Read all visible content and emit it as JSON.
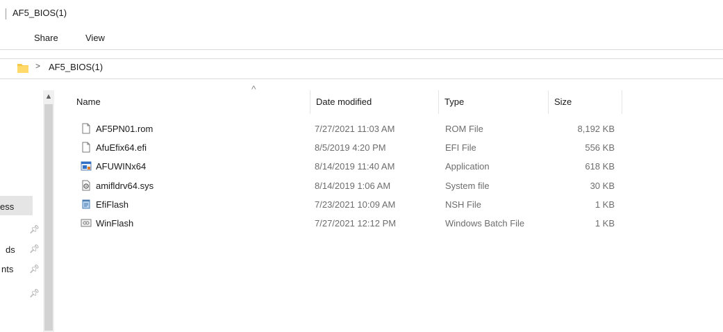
{
  "window": {
    "title": "AF5_BIOS(1)"
  },
  "ribbon": {
    "tabs": [
      {
        "label": "Share"
      },
      {
        "label": "View"
      }
    ]
  },
  "address": {
    "chevron": ">",
    "crumb": "AF5_BIOS(1)"
  },
  "nav": {
    "items": [
      {
        "label": "ess",
        "pinned": false
      },
      {
        "label": "",
        "pinned": true
      },
      {
        "label": "ds",
        "pinned": true
      },
      {
        "label": "nts",
        "pinned": true
      },
      {
        "label": "",
        "pinned": true
      }
    ]
  },
  "columns": {
    "name": "Name",
    "date": "Date modified",
    "type": "Type",
    "size": "Size",
    "sort_arrow": "^"
  },
  "files": [
    {
      "name": "AF5PN01.rom",
      "date": "7/27/2021 11:03 AM",
      "type": "ROM File",
      "size": "8,192 KB",
      "icon": "blank-file-icon"
    },
    {
      "name": "AfuEfix64.efi",
      "date": "8/5/2019 4:20 PM",
      "type": "EFI File",
      "size": "556 KB",
      "icon": "blank-file-icon"
    },
    {
      "name": "AFUWINx64",
      "date": "8/14/2019 11:40 AM",
      "type": "Application",
      "size": "618 KB",
      "icon": "application-icon"
    },
    {
      "name": "amifldrv64.sys",
      "date": "8/14/2019 1:06 AM",
      "type": "System file",
      "size": "30 KB",
      "icon": "system-file-icon"
    },
    {
      "name": "EfiFlash",
      "date": "7/23/2021 10:09 AM",
      "type": "NSH File",
      "size": "1 KB",
      "icon": "script-file-icon"
    },
    {
      "name": "WinFlash",
      "date": "7/27/2021 12:12 PM",
      "type": "Windows Batch File",
      "size": "1 KB",
      "icon": "batch-file-icon"
    }
  ],
  "colors": {
    "folder": "#f7c948",
    "selected_nav": "#e5e5e5",
    "scrollbar_track": "#f0f0f0",
    "scrollbar_thumb": "#d2d2d2"
  }
}
